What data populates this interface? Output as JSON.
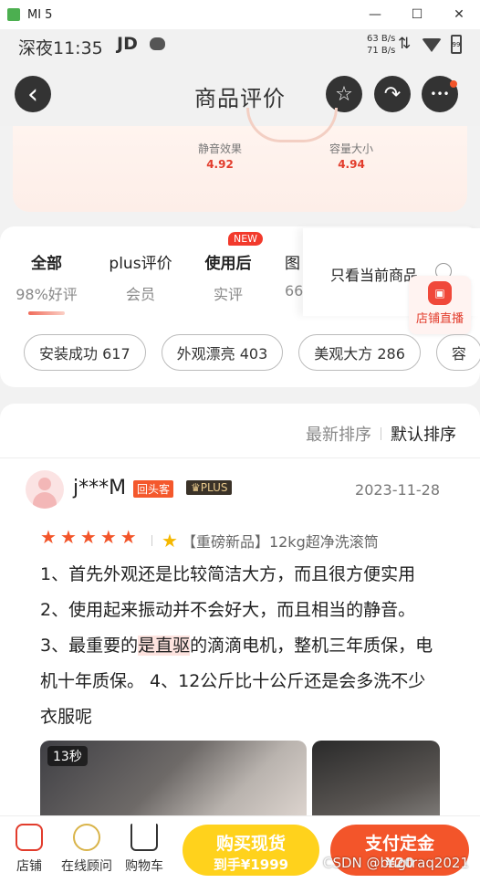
{
  "window": {
    "title": "MI 5",
    "minimize": "—",
    "maximize": "☐",
    "close": "✕"
  },
  "status": {
    "time": "深夜11:35",
    "app": "JD",
    "net_up": "63 B/s",
    "net_down": "71 B/s",
    "battery": "99"
  },
  "header": {
    "title": "商品评价",
    "back_glyph": "‹",
    "fav_glyph": "☆",
    "share_glyph": "↷",
    "more_glyph": "•••"
  },
  "scores": [
    {
      "label": "静音效果",
      "value": "4.92"
    },
    {
      "label": "容量大小",
      "value": "4.94"
    }
  ],
  "tabs": [
    {
      "title": "全部",
      "sub": "98%好评"
    },
    {
      "title": "plus评价",
      "sub": "会员"
    },
    {
      "title": "使用后",
      "sub": "实评"
    },
    {
      "title": "图",
      "sub": "66"
    }
  ],
  "new_badge": "NEW",
  "only_current": "只看当前商品",
  "live": {
    "label": "店铺直播"
  },
  "chips": [
    "安装成功 617",
    "外观漂亮 403",
    "美观大方 286",
    "容"
  ],
  "sort": {
    "latest": "最新排序",
    "default": "默认排序"
  },
  "review": {
    "user": "j***M",
    "badge_new": "回头客",
    "badge_plus": "♛PLUS",
    "date": "2023-11-28",
    "rating": 5,
    "spec": "【重磅新品】12kg超净洗滚筒",
    "content_a": "1、首先外观还是比较简洁大方，而且很方便实用 2、使用起来振动并不会好大，而且相当的静音。 3、最重要的",
    "content_hl": "是直驱",
    "content_b": "的滴滴电机，整机三年质保，电机十年质保。 4、12公斤比十公斤还是会多洗不少衣服呢",
    "video_duration": "13秒"
  },
  "bottom": {
    "store": "店铺",
    "advisor": "在线顾问",
    "cart": "购物车",
    "buy_l1": "购买现货",
    "buy_l2": "到手¥1999",
    "pay_l1": "支付定金",
    "pay_l2": "¥20"
  },
  "watermark": "CSDN @bugtraq2021",
  "colors": {
    "accent": "#f3552a",
    "buy": "#ffd21c",
    "price_red": "#e23c2c"
  }
}
